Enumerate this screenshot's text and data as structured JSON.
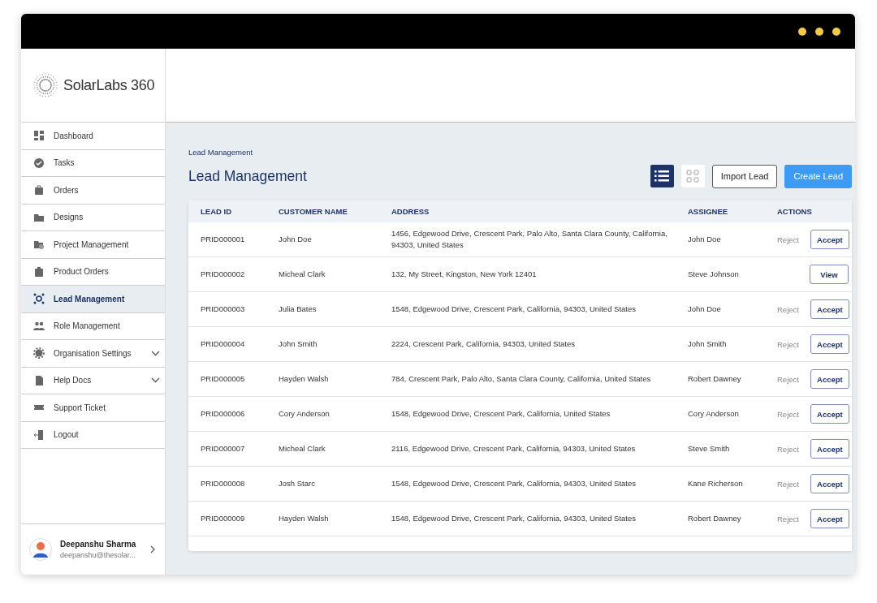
{
  "brand": {
    "name": "SolarLabs 360"
  },
  "sidebar": {
    "items": [
      {
        "label": "Dashboard",
        "selected": false,
        "expandable": false
      },
      {
        "label": "Tasks",
        "selected": false,
        "expandable": false
      },
      {
        "label": "Orders",
        "selected": false,
        "expandable": false
      },
      {
        "label": "Designs",
        "selected": false,
        "expandable": false
      },
      {
        "label": "Project Management",
        "selected": false,
        "expandable": false
      },
      {
        "label": "Product Orders",
        "selected": false,
        "expandable": false
      },
      {
        "label": "Lead Management",
        "selected": true,
        "expandable": false
      },
      {
        "label": "Role Management",
        "selected": false,
        "expandable": false
      },
      {
        "label": "Organisation Settings",
        "selected": false,
        "expandable": true
      },
      {
        "label": "Help Docs",
        "selected": false,
        "expandable": true
      },
      {
        "label": "Support Ticket",
        "selected": false,
        "expandable": false
      },
      {
        "label": "Logout",
        "selected": false,
        "expandable": false
      }
    ]
  },
  "user": {
    "name": "Deepanshu Sharma",
    "email": "deepanshu@thesolar..."
  },
  "breadcrumb": "Lead Management",
  "page_title": "Lead Management",
  "view_toggle": [
    {
      "selected": true
    },
    {
      "selected": false
    }
  ],
  "buttons": {
    "import": "Import Lead",
    "create": "Create Lead"
  },
  "table": {
    "columns": [
      "LEAD ID",
      "CUSTOMER NAME",
      "ADDRESS",
      "ASSIGNEE",
      "ACTIONS"
    ],
    "rows": [
      {
        "id": "PRID000001",
        "customer": "John Doe",
        "address": "1456, Edgewood Drive, Crescent Park, Palo Alto, Santa Clara County, California, 94303, United States",
        "assignee": "John Doe",
        "kind": "pending",
        "reject": "Reject",
        "action": "Accept"
      },
      {
        "id": "PRID000002",
        "customer": "Micheal Clark",
        "address": "132, My Street, Kingston, New York 12401",
        "assignee": "Steve Johnson",
        "kind": "accepted",
        "action": "View"
      },
      {
        "id": "PRID000003",
        "customer": "Julia Bates",
        "address": "1548, Edgewood Drive, Crescent Park, California, 94303, United States",
        "assignee": "John Doe",
        "kind": "pending",
        "reject": "Reject",
        "action": "Accept"
      },
      {
        "id": "PRID000004",
        "customer": "John Smith",
        "address": "2224, Crescent Park, California, 94303, United States",
        "assignee": "John Smith",
        "kind": "pending",
        "reject": "Reject",
        "action": "Accept"
      },
      {
        "id": "PRID000005",
        "customer": "Hayden Walsh",
        "address": "784, Crescent Park, Palo Alto, Santa Clara County, California, United States",
        "assignee": "Robert Dawney",
        "kind": "pending",
        "reject": "Reject",
        "action": "Accept"
      },
      {
        "id": "PRID000006",
        "customer": "Cory Anderson",
        "address": "1548, Edgewood Drive, Crescent Park, California, United States",
        "assignee": "Cory Anderson",
        "kind": "pending",
        "reject": "Reject",
        "action": "Accept"
      },
      {
        "id": "PRID000007",
        "customer": "Micheal Clark",
        "address": "2116, Edgewood Drive, Crescent Park, California, 94303, United States",
        "assignee": "Steve Smith",
        "kind": "pending",
        "reject": "Reject",
        "action": "Accept"
      },
      {
        "id": "PRID000008",
        "customer": "Josh Starc",
        "address": "1548, Edgewood Drive, Crescent Park, California, 94303, United States",
        "assignee": "Kane Richerson",
        "kind": "pending",
        "reject": "Reject",
        "action": "Accept"
      },
      {
        "id": "PRID000009",
        "customer": "Hayden Walsh",
        "address": "1548, Edgewood Drive, Crescent Park, California, 94303, United States",
        "assignee": "Robert Dawney",
        "kind": "pending",
        "reject": "Reject",
        "action": "Accept"
      }
    ]
  }
}
